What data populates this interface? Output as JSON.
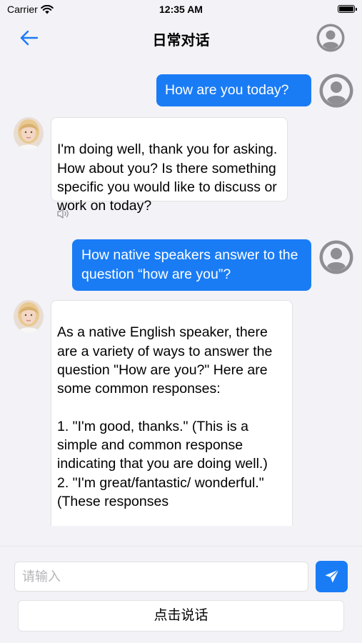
{
  "status_bar": {
    "carrier": "Carrier",
    "time": "12:35 AM"
  },
  "nav": {
    "title": "日常对话",
    "back_icon": "arrow-left-icon",
    "avatar_icon": "user-avatar-icon"
  },
  "messages": [
    {
      "role": "user",
      "text": "How are you today?"
    },
    {
      "role": "assistant",
      "text": "I'm doing well, thank you for asking. How about you? Is there something specific you would like to discuss or work on today?"
    },
    {
      "role": "user",
      "text": "How native speakers answer to the question “how are you”?"
    },
    {
      "role": "assistant",
      "text": "As a native English speaker, there are a variety of ways to answer the question \"How are you?\" Here are some common responses:\n\n1. \"I'm good, thanks.\" (This is a simple and common response indicating that you are doing well.)\n2. \"I'm great/fantastic/ wonderful.\" (These responses"
    }
  ],
  "input": {
    "placeholder": "请输入",
    "value": ""
  },
  "speak_button": {
    "label": "点击说话"
  },
  "colors": {
    "accent": "#1a7cf5",
    "background": "#f2f2f7",
    "avatar_gray": "#8e8e93"
  }
}
